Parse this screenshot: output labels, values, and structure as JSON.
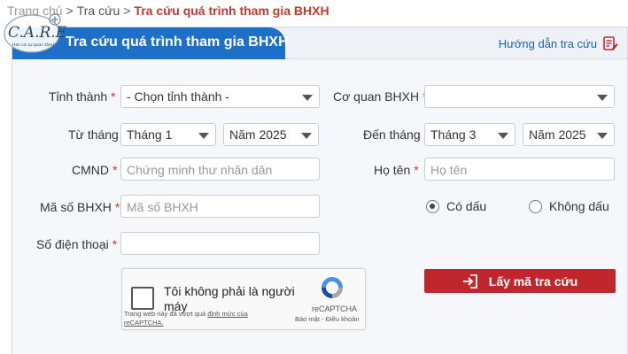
{
  "breadcrumb": {
    "item1": "Trang chủ",
    "item2": "Tra cứu",
    "current": "Tra cứu quá trình tham gia BHXH",
    "separator": ">"
  },
  "logo": {
    "name": "C.A.R.E",
    "tagline": "Hơn cả sự quan tâm!"
  },
  "panel": {
    "title": "Tra cứu quá trình tham gia BHXH",
    "guide_label": "Hướng dẫn tra cứu"
  },
  "form": {
    "province": {
      "label": "Tỉnh thành",
      "value": "- Chọn tỉnh thành -"
    },
    "agency": {
      "label": "Cơ quan BHXH",
      "value": ""
    },
    "from": {
      "label": "Từ tháng",
      "month": "Tháng 1",
      "year": "Năm 2025"
    },
    "to": {
      "label": "Đến tháng",
      "month": "Tháng 3",
      "year": "Năm 2025"
    },
    "id_card": {
      "label": "CMND",
      "placeholder": "Chứng minh thư nhân dân"
    },
    "fullname": {
      "label": "Họ tên",
      "placeholder": "Họ tên"
    },
    "bhxh_code": {
      "label": "Mã số BHXH",
      "placeholder": "Mã số BHXH"
    },
    "phone": {
      "label": "Số điện thoại",
      "placeholder": ""
    },
    "accent": {
      "option1": "Có dấu",
      "option2": "Không dấu",
      "selected": "Có dấu"
    },
    "required_mark": "*"
  },
  "captcha": {
    "label": "Tôi không phải là người máy",
    "note_line1_prefix": "Trang web này đã vượt quá ",
    "note_link": "định mức của",
    "note_line2": "reCAPTCHA.",
    "brand": "reCAPTCHA",
    "links": "Bảo mật - Điều khoản"
  },
  "submit": {
    "label": "Lấy mã tra cứu"
  },
  "colors": {
    "primary": "#1e6fc8",
    "accent_red": "#c0272d",
    "required": "#c0392b"
  }
}
